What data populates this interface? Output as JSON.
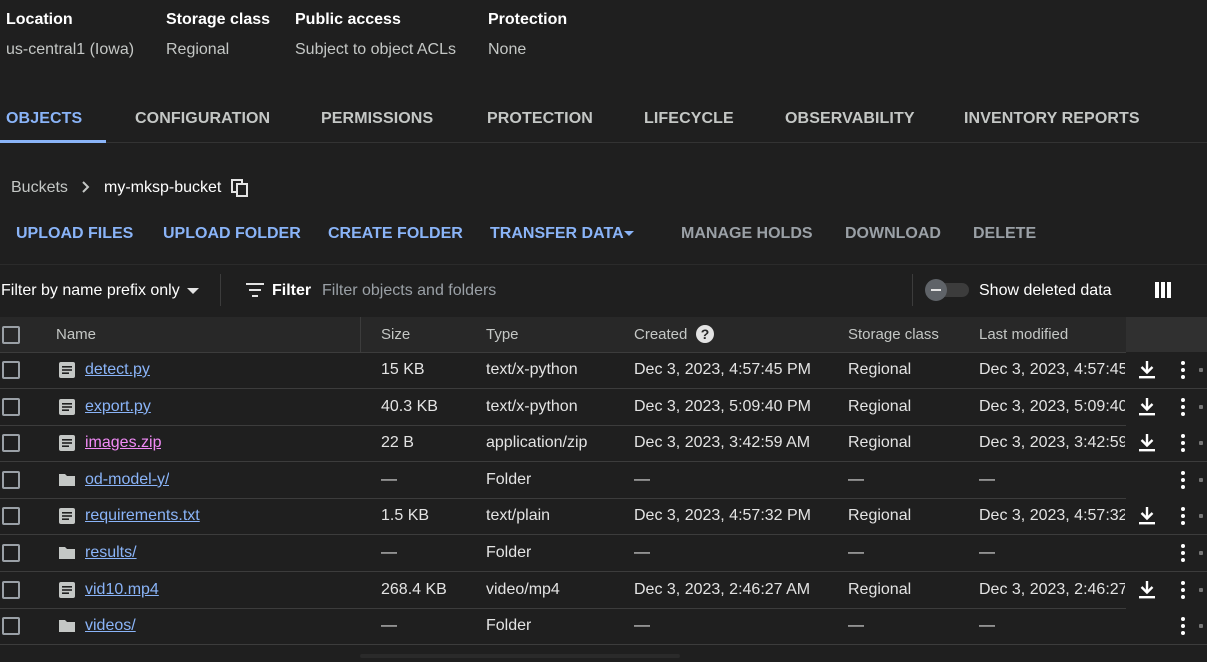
{
  "info": [
    {
      "label": "Location",
      "value": "us-central1 (Iowa)"
    },
    {
      "label": "Storage class",
      "value": "Regional"
    },
    {
      "label": "Public access",
      "value": "Subject to object ACLs"
    },
    {
      "label": "Protection",
      "value": "None"
    }
  ],
  "tabs": [
    "OBJECTS",
    "CONFIGURATION",
    "PERMISSIONS",
    "PROTECTION",
    "LIFECYCLE",
    "OBSERVABILITY",
    "INVENTORY REPORTS"
  ],
  "active_tab": "OBJECTS",
  "breadcrumb": {
    "root": "Buckets",
    "current": "my-mksp-bucket"
  },
  "actions": {
    "upload_files": "UPLOAD FILES",
    "upload_folder": "UPLOAD FOLDER",
    "create_folder": "CREATE FOLDER",
    "transfer_data": "TRANSFER DATA",
    "manage_holds": "MANAGE HOLDS",
    "download": "DOWNLOAD",
    "delete": "DELETE"
  },
  "filter": {
    "prefix_mode": "Filter by name prefix only",
    "label": "Filter",
    "placeholder": "Filter objects and folders",
    "show_deleted": "Show deleted data"
  },
  "columns": {
    "name": "Name",
    "size": "Size",
    "type": "Type",
    "created": "Created",
    "storage_class": "Storage class",
    "last_modified": "Last modified"
  },
  "rows": [
    {
      "kind": "file",
      "name": "detect.py",
      "size": "15 KB",
      "type": "text/x-python",
      "created": "Dec 3, 2023, 4:57:45 PM",
      "storage_class": "Regional",
      "last_modified": "Dec 3, 2023, 4:57:45",
      "visited": false
    },
    {
      "kind": "file",
      "name": "export.py",
      "size": "40.3 KB",
      "type": "text/x-python",
      "created": "Dec 3, 2023, 5:09:40 PM",
      "storage_class": "Regional",
      "last_modified": "Dec 3, 2023, 5:09:40",
      "visited": false
    },
    {
      "kind": "file",
      "name": "images.zip",
      "size": "22 B",
      "type": "application/zip",
      "created": "Dec 3, 2023, 3:42:59 AM",
      "storage_class": "Regional",
      "last_modified": "Dec 3, 2023, 3:42:59",
      "visited": true
    },
    {
      "kind": "folder",
      "name": "od-model-y/",
      "size": "—",
      "type": "Folder",
      "created": "—",
      "storage_class": "—",
      "last_modified": "—",
      "visited": false
    },
    {
      "kind": "file",
      "name": "requirements.txt",
      "size": "1.5 KB",
      "type": "text/plain",
      "created": "Dec 3, 2023, 4:57:32 PM",
      "storage_class": "Regional",
      "last_modified": "Dec 3, 2023, 4:57:32",
      "visited": false
    },
    {
      "kind": "folder",
      "name": "results/",
      "size": "—",
      "type": "Folder",
      "created": "—",
      "storage_class": "—",
      "last_modified": "—",
      "visited": false
    },
    {
      "kind": "file",
      "name": "vid10.mp4",
      "size": "268.4 KB",
      "type": "video/mp4",
      "created": "Dec 3, 2023, 2:46:27 AM",
      "storage_class": "Regional",
      "last_modified": "Dec 3, 2023, 2:46:27",
      "visited": false
    },
    {
      "kind": "folder",
      "name": "videos/",
      "size": "—",
      "type": "Folder",
      "created": "—",
      "storage_class": "—",
      "last_modified": "—",
      "visited": false
    }
  ],
  "colors": {
    "accent": "#8ab4f8",
    "visited_link": "#f28bf7",
    "background": "#1f1f1f"
  }
}
